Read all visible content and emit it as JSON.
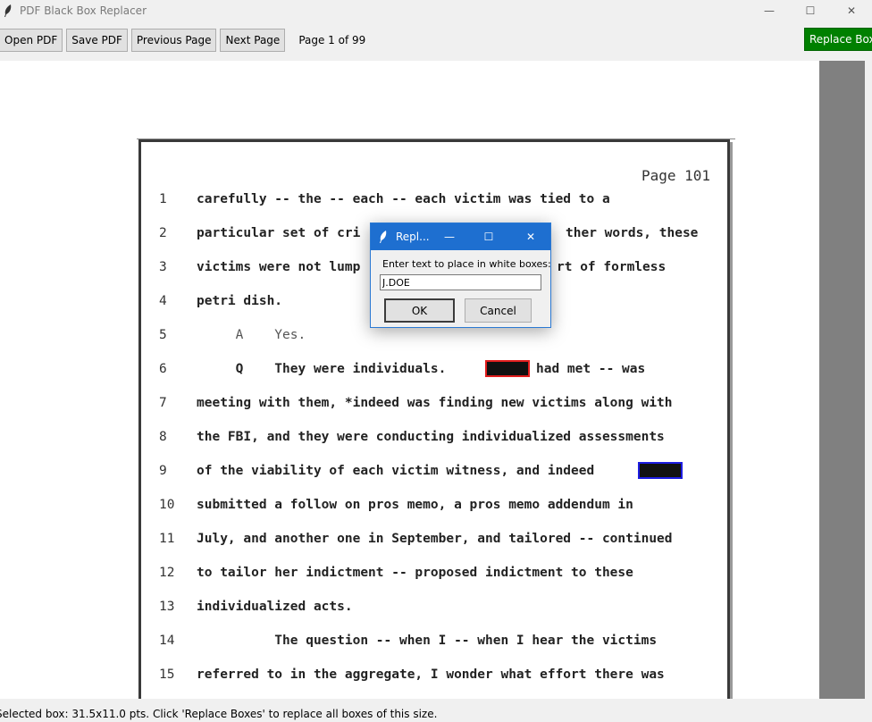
{
  "window": {
    "title": "PDF Black Box Replacer",
    "minimize": "—",
    "maximize": "☐",
    "close": "✕"
  },
  "toolbar": {
    "open_label": "Open PDF",
    "save_label": "Save PDF",
    "prev_label": "Previous Page",
    "next_label": "Next Page",
    "page_indicator": "Page 1 of 99",
    "replace_label": "Replace Boxes",
    "replace_color": "#008000"
  },
  "document": {
    "page_header": "Page 101",
    "lines": [
      {
        "num": "1",
        "text": "carefully -- the -- each -- each victim was tied to a"
      },
      {
        "num": "2",
        "text": "particular set of cri",
        "text_after": "ther words, these"
      },
      {
        "num": "3",
        "text": "victims were not lump",
        "text_after": "rt of formless"
      },
      {
        "num": "4",
        "text": "petri dish."
      },
      {
        "num": "5",
        "text": "     A    Yes."
      },
      {
        "num": "6",
        "text": "     Q    They were individuals.",
        "text_after": "had met -- was"
      },
      {
        "num": "7",
        "text": "meeting with them, *indeed was finding new victims along with"
      },
      {
        "num": "8",
        "text": "the FBI, and they were conducting individualized assessments"
      },
      {
        "num": "9",
        "text": "of the viability of each victim witness, and indeed"
      },
      {
        "num": "10",
        "text": "submitted a follow on pros memo, a pros memo addendum in"
      },
      {
        "num": "11",
        "text": "July, and another one in September, and tailored -- continued"
      },
      {
        "num": "12",
        "text": "to tailor her indictment -- proposed indictment to these"
      },
      {
        "num": "13",
        "text": "individualized acts."
      },
      {
        "num": "14",
        "text": "          The question -- when I -- when I hear the victims"
      },
      {
        "num": "15",
        "text": "referred to in the aggregate, I wonder what effort there was"
      }
    ]
  },
  "dialog": {
    "title": "Repl...",
    "prompt": "Enter text to place in white boxes:",
    "input_value": "J.DOE",
    "ok_label": "OK",
    "cancel_label": "Cancel",
    "minimize": "—",
    "maximize": "☐",
    "close": "✕"
  },
  "status": {
    "text": "Selected box: 31.5x11.0 pts. Click 'Replace Boxes' to replace all boxes of this size."
  },
  "colors": {
    "redact_selected": "#e11d1d",
    "redact_match": "#1d1de1",
    "dialog_titlebar": "#1e6fd0"
  }
}
